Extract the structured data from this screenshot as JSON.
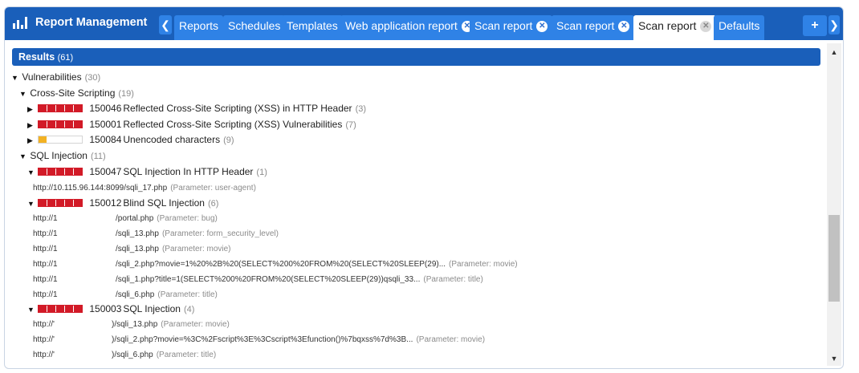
{
  "app": {
    "title": "Report Management"
  },
  "tabs": [
    {
      "label": "Reports",
      "closable": false,
      "active": false
    },
    {
      "label": "Schedules",
      "closable": false,
      "active": false
    },
    {
      "label": "Templates",
      "closable": false,
      "active": false
    },
    {
      "label": "Web application report",
      "closable": true,
      "active": false
    },
    {
      "label": "Scan report",
      "closable": true,
      "active": false
    },
    {
      "label": "Scan report",
      "closable": true,
      "active": false
    },
    {
      "label": "Scan report",
      "closable": true,
      "active": true
    },
    {
      "label": "Defaults",
      "closable": false,
      "active": false
    }
  ],
  "add_tab_label": "+",
  "results": {
    "label": "Results",
    "count": "(61)"
  },
  "tree": {
    "vulnerabilities": {
      "label": "Vulnerabilities",
      "count": "(30)"
    },
    "xss": {
      "label": "Cross-Site Scripting",
      "count": "(19)",
      "items": [
        {
          "qid": "150046",
          "title": "Reflected Cross-Site Scripting (XSS) in HTTP Header",
          "count": "(3)"
        },
        {
          "qid": "150001",
          "title": "Reflected Cross-Site Scripting (XSS) Vulnerabilities",
          "count": "(7)"
        },
        {
          "qid": "150084",
          "title": "Unencoded characters",
          "count": "(9)"
        }
      ]
    },
    "sqli": {
      "label": "SQL Injection",
      "count": "(11)",
      "items": [
        {
          "qid": "150047",
          "title": "SQL Injection In HTTP Header",
          "count": "(1)",
          "urls": [
            {
              "url": "http://10.115.96.144:8099/sqli_17.php",
              "param": "(Parameter: user-agent)"
            }
          ]
        },
        {
          "qid": "150012",
          "title": "Blind SQL Injection",
          "count": "(6)",
          "urls": [
            {
              "host": "http://1",
              "path": "/portal.php",
              "param": "(Parameter: bug)"
            },
            {
              "host": "http://1",
              "path": "/sqli_13.php",
              "param": "(Parameter: form_security_level)"
            },
            {
              "host": "http://1",
              "path": "/sqli_13.php",
              "param": "(Parameter: movie)"
            },
            {
              "host": "http://1",
              "path": "/sqli_2.php?movie=1%20%2B%20(SELECT%200%20FROM%20(SELECT%20SLEEP(29)...",
              "param": "(Parameter: movie)"
            },
            {
              "host": "http://1",
              "path": "/sqli_1.php?title=1(SELECT%200%20FROM%20(SELECT%20SLEEP(29))qsqli_33...",
              "param": "(Parameter: title)"
            },
            {
              "host": "http://1",
              "path": "/sqli_6.php",
              "param": "(Parameter: title)"
            }
          ]
        },
        {
          "qid": "150003",
          "title": "SQL Injection",
          "count": "(4)",
          "urls": [
            {
              "host": "http://'",
              "path": ")/sqli_13.php",
              "param": "(Parameter: movie)"
            },
            {
              "host": "http://'",
              "path": ")/sqli_2.php?movie=%3C%2Fscript%3E%3Cscript%3Efunction()%7bqxss%7d%3B...",
              "param": "(Parameter: movie)"
            },
            {
              "host": "http://'",
              "path": ")/sqli_6.php",
              "param": "(Parameter: title)"
            }
          ]
        }
      ]
    }
  },
  "icons": {
    "brand": "bar-chart-icon",
    "expanded": "triangle-down-icon",
    "collapsed": "triangle-right-icon",
    "close": "close-icon"
  },
  "colors": {
    "header": "#1a5fba",
    "tab": "#2f82e6",
    "severity_high": "#d21a27",
    "severity_low": "#f3b223"
  }
}
